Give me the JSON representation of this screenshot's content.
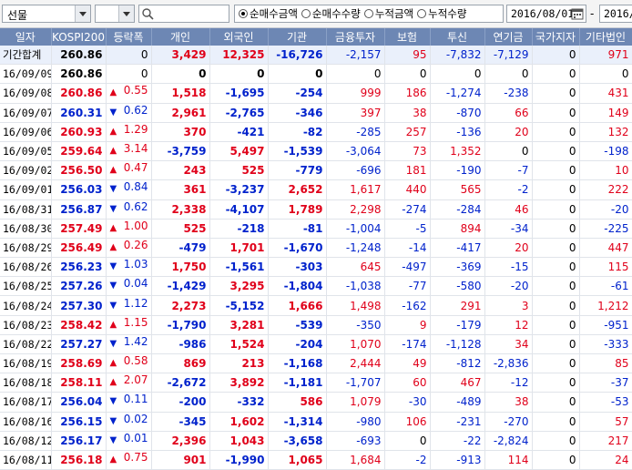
{
  "toolbar": {
    "market_select": "선물",
    "sub_select": "",
    "search_placeholder": "",
    "radio_options": [
      {
        "label": "순매수금액",
        "selected": true
      },
      {
        "label": "순매수수량",
        "selected": false
      },
      {
        "label": "누적금액",
        "selected": false
      },
      {
        "label": "누적수량",
        "selected": false
      }
    ],
    "start_date": "2016/08/01",
    "range_dash": "-",
    "end_date": "2016/"
  },
  "columns": [
    "일자",
    "KOSPI200",
    "등락폭",
    "개인",
    "외국인",
    "기관",
    "금융투자",
    "보험",
    "투신",
    "연기금",
    "국가지자",
    "기타법인"
  ],
  "colors": {
    "header_bg": "#6d87b4",
    "up": "#e0001a",
    "down": "#0022cc",
    "summary_bg": "#eaf0fb"
  },
  "rows": [
    {
      "date": "기간합계",
      "kospi": "260.86",
      "dir": "",
      "chg": "0",
      "v": [
        "3,429",
        "12,325",
        "-16,726",
        "-2,157",
        "95",
        "-7,832",
        "-7,129",
        "0",
        "971"
      ],
      "summary": true
    },
    {
      "date": "16/09/09",
      "kospi": "260.86",
      "dir": "",
      "chg": "0",
      "v": [
        "0",
        "0",
        "0",
        "0",
        "0",
        "0",
        "0",
        "0",
        "0"
      ]
    },
    {
      "date": "16/09/08",
      "kospi": "260.86",
      "dir": "up",
      "chg": "0.55",
      "v": [
        "1,518",
        "-1,695",
        "-254",
        "999",
        "186",
        "-1,274",
        "-238",
        "0",
        "431"
      ]
    },
    {
      "date": "16/09/07",
      "kospi": "260.31",
      "dir": "dn",
      "chg": "0.62",
      "v": [
        "2,961",
        "-2,765",
        "-346",
        "397",
        "38",
        "-870",
        "66",
        "0",
        "149"
      ]
    },
    {
      "date": "16/09/06",
      "kospi": "260.93",
      "dir": "up",
      "chg": "1.29",
      "v": [
        "370",
        "-421",
        "-82",
        "-285",
        "257",
        "-136",
        "20",
        "0",
        "132"
      ]
    },
    {
      "date": "16/09/05",
      "kospi": "259.64",
      "dir": "up",
      "chg": "3.14",
      "v": [
        "-3,759",
        "5,497",
        "-1,539",
        "-3,064",
        "73",
        "1,352",
        "0",
        "0",
        "-198"
      ]
    },
    {
      "date": "16/09/02",
      "kospi": "256.50",
      "dir": "up",
      "chg": "0.47",
      "v": [
        "243",
        "525",
        "-779",
        "-696",
        "181",
        "-190",
        "-7",
        "0",
        "10"
      ]
    },
    {
      "date": "16/09/01",
      "kospi": "256.03",
      "dir": "dn",
      "chg": "0.84",
      "v": [
        "361",
        "-3,237",
        "2,652",
        "1,617",
        "440",
        "565",
        "-2",
        "0",
        "222"
      ]
    },
    {
      "date": "16/08/31",
      "kospi": "256.87",
      "dir": "dn",
      "chg": "0.62",
      "v": [
        "2,338",
        "-4,107",
        "1,789",
        "2,298",
        "-274",
        "-284",
        "46",
        "0",
        "-20"
      ]
    },
    {
      "date": "16/08/30",
      "kospi": "257.49",
      "dir": "up",
      "chg": "1.00",
      "v": [
        "525",
        "-218",
        "-81",
        "-1,004",
        "-5",
        "894",
        "-34",
        "0",
        "-225"
      ]
    },
    {
      "date": "16/08/29",
      "kospi": "256.49",
      "dir": "up",
      "chg": "0.26",
      "v": [
        "-479",
        "1,701",
        "-1,670",
        "-1,248",
        "-14",
        "-417",
        "20",
        "0",
        "447"
      ]
    },
    {
      "date": "16/08/26",
      "kospi": "256.23",
      "dir": "dn",
      "chg": "1.03",
      "v": [
        "1,750",
        "-1,561",
        "-303",
        "645",
        "-497",
        "-369",
        "-15",
        "0",
        "115"
      ]
    },
    {
      "date": "16/08/25",
      "kospi": "257.26",
      "dir": "dn",
      "chg": "0.04",
      "v": [
        "-1,429",
        "3,295",
        "-1,804",
        "-1,038",
        "-77",
        "-580",
        "-20",
        "0",
        "-61"
      ]
    },
    {
      "date": "16/08/24",
      "kospi": "257.30",
      "dir": "dn",
      "chg": "1.12",
      "v": [
        "2,273",
        "-5,152",
        "1,666",
        "1,498",
        "-162",
        "291",
        "3",
        "0",
        "1,212"
      ]
    },
    {
      "date": "16/08/23",
      "kospi": "258.42",
      "dir": "up",
      "chg": "1.15",
      "v": [
        "-1,790",
        "3,281",
        "-539",
        "-350",
        "9",
        "-179",
        "12",
        "0",
        "-951"
      ]
    },
    {
      "date": "16/08/22",
      "kospi": "257.27",
      "dir": "dn",
      "chg": "1.42",
      "v": [
        "-986",
        "1,524",
        "-204",
        "1,070",
        "-174",
        "-1,128",
        "34",
        "0",
        "-333"
      ]
    },
    {
      "date": "16/08/19",
      "kospi": "258.69",
      "dir": "up",
      "chg": "0.58",
      "v": [
        "869",
        "213",
        "-1,168",
        "2,444",
        "49",
        "-812",
        "-2,836",
        "0",
        "85"
      ]
    },
    {
      "date": "16/08/18",
      "kospi": "258.11",
      "dir": "up",
      "chg": "2.07",
      "v": [
        "-2,672",
        "3,892",
        "-1,181",
        "-1,707",
        "60",
        "467",
        "-12",
        "0",
        "-37"
      ]
    },
    {
      "date": "16/08/17",
      "kospi": "256.04",
      "dir": "dn",
      "chg": "0.11",
      "v": [
        "-200",
        "-332",
        "586",
        "1,079",
        "-30",
        "-489",
        "38",
        "0",
        "-53"
      ]
    },
    {
      "date": "16/08/16",
      "kospi": "256.15",
      "dir": "dn",
      "chg": "0.02",
      "v": [
        "-345",
        "1,602",
        "-1,314",
        "-980",
        "106",
        "-231",
        "-270",
        "0",
        "57"
      ]
    },
    {
      "date": "16/08/12",
      "kospi": "256.17",
      "dir": "dn",
      "chg": "0.01",
      "v": [
        "2,396",
        "1,043",
        "-3,658",
        "-693",
        "0",
        "-22",
        "-2,824",
        "0",
        "217"
      ]
    },
    {
      "date": "16/08/11",
      "kospi": "256.18",
      "dir": "up",
      "chg": "0.75",
      "v": [
        "901",
        "-1,990",
        "1,065",
        "1,684",
        "-2",
        "-913",
        "114",
        "0",
        "24"
      ]
    }
  ]
}
